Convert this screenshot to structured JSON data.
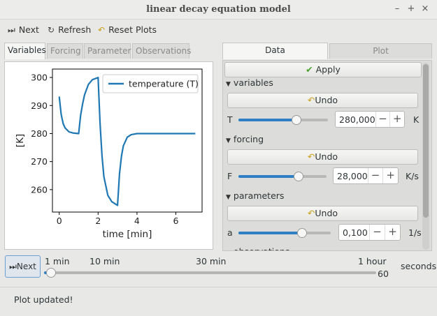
{
  "window": {
    "title": "linear decay equation model",
    "controls": [
      "–",
      "+",
      "×"
    ]
  },
  "toolbar": {
    "next_label": "Next",
    "refresh_label": "Refresh",
    "reset_label": "Reset Plots"
  },
  "left_tabs": [
    "Variables",
    "Forcing",
    "Parameter",
    "Observations"
  ],
  "right_tabs": [
    "Data",
    "Plot"
  ],
  "chart_data": {
    "type": "line",
    "xlabel": "time [min]",
    "ylabel": "[K]",
    "xlim": [
      -0.35,
      7.35
    ],
    "ylim": [
      252,
      303
    ],
    "xticks": [
      0,
      2,
      4,
      6
    ],
    "yticks": [
      260,
      270,
      280,
      290,
      300
    ],
    "series": [
      {
        "name": "temperature (T)",
        "color": "#1f77b4",
        "x": [
          0.0,
          0.1,
          0.2,
          0.3,
          0.5,
          0.7,
          1.0,
          1.001,
          1.1,
          1.2,
          1.3,
          1.5,
          1.7,
          2.0,
          2.001,
          2.1,
          2.2,
          2.3,
          2.5,
          2.7,
          3.0,
          3.001,
          3.1,
          3.2,
          3.3,
          3.5,
          3.7,
          4.0,
          5.0,
          6.0,
          7.0
        ],
        "y": [
          293.2,
          286.8,
          283.6,
          282.0,
          280.6,
          280.2,
          280.0,
          280.0,
          286.5,
          290.5,
          293.8,
          297.5,
          299.2,
          300.0,
          300.0,
          283.6,
          272.0,
          264.6,
          258.0,
          255.7,
          254.4,
          254.4,
          265.6,
          271.9,
          275.6,
          278.7,
          279.6,
          280.0,
          280.0,
          280.0,
          280.0
        ]
      }
    ]
  },
  "data_panel": {
    "apply_label": "Apply",
    "sections": [
      {
        "title": "variables",
        "undo_label": "Undo",
        "param": "T",
        "value": "280,000",
        "unit": "K",
        "level": 0.65
      },
      {
        "title": "forcing",
        "undo_label": "Undo",
        "param": "F",
        "value": "28,000",
        "unit": "K/s",
        "level": 0.68
      },
      {
        "title": "parameters",
        "undo_label": "Undo",
        "param": "a",
        "value": "0,100",
        "unit": "1/s",
        "level": 0.69
      }
    ],
    "partial_section": "observations"
  },
  "time_slider": {
    "next_label": "Next",
    "ticks": [
      "1 min",
      "10 min",
      "30 min",
      "1 hour"
    ],
    "unit": "seconds",
    "value": "60",
    "level": 0.02
  },
  "status": {
    "message": "Plot updated!"
  }
}
